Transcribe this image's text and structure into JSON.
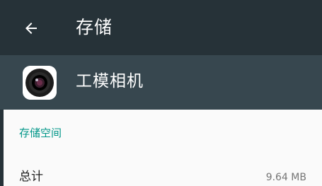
{
  "toolbar": {
    "back_icon": "arrow-back-icon",
    "title": "存储",
    "background": "#263238"
  },
  "app_header": {
    "icon": "camera-app-icon",
    "name": "工模相机",
    "background": "#37474f"
  },
  "storage_section": {
    "header": "存储空间",
    "accent_color": "#009688",
    "rows": [
      {
        "label": "总计",
        "value": "9.64 MB"
      }
    ]
  }
}
